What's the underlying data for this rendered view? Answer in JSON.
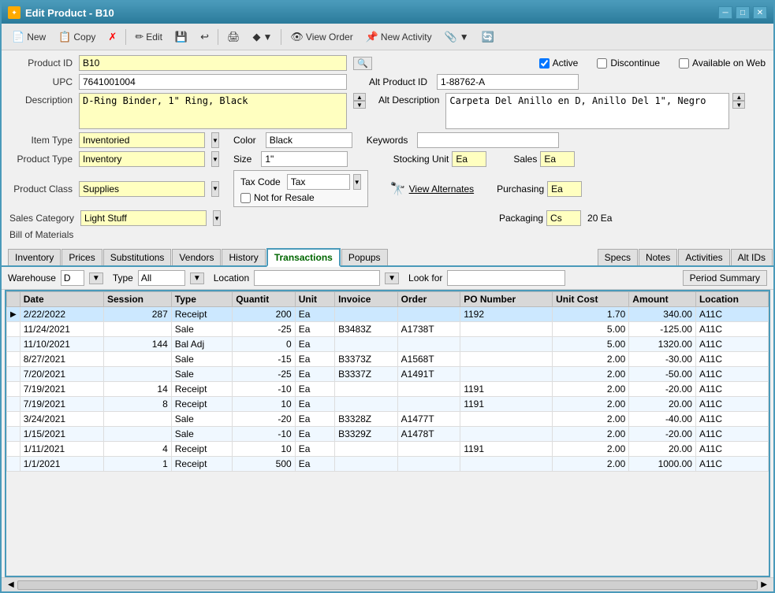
{
  "window": {
    "title": "Edit Product - B10",
    "icon": "✦"
  },
  "toolbar": {
    "buttons": [
      {
        "name": "new-button",
        "label": "New",
        "icon": "📄"
      },
      {
        "name": "copy-button",
        "label": "Copy",
        "icon": "📋"
      },
      {
        "name": "delete-button",
        "label": "",
        "icon": "✗"
      },
      {
        "name": "edit-button",
        "label": "Edit",
        "icon": "✏"
      },
      {
        "name": "save-button",
        "label": "",
        "icon": "💾"
      },
      {
        "name": "undo-button",
        "label": "",
        "icon": "↩"
      },
      {
        "name": "print-button",
        "label": "",
        "icon": "🖨"
      },
      {
        "name": "options-button",
        "label": "",
        "icon": "◆"
      },
      {
        "name": "view-order-button",
        "label": "View Order",
        "icon": "👁"
      },
      {
        "name": "new-activity-button",
        "label": "New Activity",
        "icon": "📌"
      },
      {
        "name": "attach-button",
        "label": "",
        "icon": "📎"
      },
      {
        "name": "refresh-button",
        "label": "",
        "icon": "🔄"
      }
    ]
  },
  "form": {
    "product_id_label": "Product ID",
    "product_id_value": "B10",
    "upc_label": "UPC",
    "upc_value": "7641001004",
    "description_label": "Description",
    "description_value": "D-Ring Binder, 1\" Ring, Black",
    "item_type_label": "Item Type",
    "item_type_value": "Inventoried",
    "product_type_label": "Product Type",
    "product_type_value": "Inventory",
    "product_class_label": "Product Class",
    "product_class_value": "Supplies",
    "sales_category_label": "Sales Category",
    "sales_category_value": "Light Stuff",
    "bill_of_materials_label": "Bill of Materials",
    "color_label": "Color",
    "color_value": "Black",
    "size_label": "Size",
    "size_value": "1\"",
    "tax_code_label": "Tax Code",
    "tax_code_value": "Tax",
    "not_for_resale_label": "Not for Resale",
    "active_label": "Active",
    "active_checked": true,
    "discontinue_label": "Discontinue",
    "discontinue_checked": false,
    "available_on_web_label": "Available on Web",
    "available_on_web_checked": false,
    "alt_product_id_label": "Alt Product ID",
    "alt_product_id_value": "1-88762-A",
    "alt_description_label": "Alt Description",
    "alt_description_value": "Carpeta Del Anillo en D, Anillo Del 1\", Negro",
    "keywords_label": "Keywords",
    "keywords_value": "",
    "stocking_unit_label": "Stocking Unit",
    "stocking_unit_value": "Ea",
    "sales_label": "Sales",
    "sales_value": "Ea",
    "purchasing_label": "Purchasing",
    "purchasing_value": "Ea",
    "packaging_label": "Packaging",
    "packaging_value": "Cs",
    "packaging_qty": "20 Ea",
    "view_alternates_label": "View Alternates"
  },
  "tabs": {
    "items": [
      {
        "name": "tab-inventory",
        "label": "Inventory"
      },
      {
        "name": "tab-prices",
        "label": "Prices"
      },
      {
        "name": "tab-substitutions",
        "label": "Substitutions"
      },
      {
        "name": "tab-vendors",
        "label": "Vendors"
      },
      {
        "name": "tab-history",
        "label": "History"
      },
      {
        "name": "tab-transactions",
        "label": "Transactions"
      },
      {
        "name": "tab-popups",
        "label": "Popups"
      },
      {
        "name": "tab-specs",
        "label": "Specs"
      },
      {
        "name": "tab-notes",
        "label": "Notes"
      },
      {
        "name": "tab-activities",
        "label": "Activities"
      },
      {
        "name": "tab-alt-ids",
        "label": "Alt IDs"
      }
    ],
    "active": "Transactions"
  },
  "transactions": {
    "warehouse_label": "Warehouse",
    "warehouse_value": "D",
    "type_label": "Type",
    "type_value": "All",
    "location_label": "Location",
    "location_value": "",
    "look_for_label": "Look for",
    "look_for_value": "",
    "period_summary_label": "Period Summary",
    "columns": [
      {
        "key": "indicator",
        "label": ""
      },
      {
        "key": "date",
        "label": "Date"
      },
      {
        "key": "session",
        "label": "Session"
      },
      {
        "key": "type",
        "label": "Type"
      },
      {
        "key": "quantity",
        "label": "Quantit"
      },
      {
        "key": "unit",
        "label": "Unit"
      },
      {
        "key": "invoice",
        "label": "Invoice"
      },
      {
        "key": "order",
        "label": "Order"
      },
      {
        "key": "po_number",
        "label": "PO Number"
      },
      {
        "key": "unit_cost",
        "label": "Unit Cost"
      },
      {
        "key": "amount",
        "label": "Amount"
      },
      {
        "key": "location",
        "label": "Location"
      }
    ],
    "rows": [
      {
        "indicator": "▶",
        "date": "2/22/2022",
        "session": "287",
        "type": "Receipt",
        "quantity": "200",
        "unit": "Ea",
        "invoice": "",
        "order": "",
        "po_number": "1192",
        "unit_cost": "1.70",
        "amount": "340.00",
        "location": "A11C",
        "selected": true
      },
      {
        "indicator": "",
        "date": "11/24/2021",
        "session": "",
        "type": "Sale",
        "quantity": "-25",
        "unit": "Ea",
        "invoice": "B3483Z",
        "order": "A1738T",
        "po_number": "",
        "unit_cost": "5.00",
        "amount": "-125.00",
        "location": "A11C",
        "selected": false
      },
      {
        "indicator": "",
        "date": "11/10/2021",
        "session": "144",
        "type": "Bal Adj",
        "quantity": "0",
        "unit": "Ea",
        "invoice": "",
        "order": "",
        "po_number": "",
        "unit_cost": "5.00",
        "amount": "1320.00",
        "location": "A11C",
        "selected": false
      },
      {
        "indicator": "",
        "date": "8/27/2021",
        "session": "",
        "type": "Sale",
        "quantity": "-15",
        "unit": "Ea",
        "invoice": "B3373Z",
        "order": "A1568T",
        "po_number": "",
        "unit_cost": "2.00",
        "amount": "-30.00",
        "location": "A11C",
        "selected": false
      },
      {
        "indicator": "",
        "date": "7/20/2021",
        "session": "",
        "type": "Sale",
        "quantity": "-25",
        "unit": "Ea",
        "invoice": "B3337Z",
        "order": "A1491T",
        "po_number": "",
        "unit_cost": "2.00",
        "amount": "-50.00",
        "location": "A11C",
        "selected": false
      },
      {
        "indicator": "",
        "date": "7/19/2021",
        "session": "14",
        "type": "Receipt",
        "quantity": "-10",
        "unit": "Ea",
        "invoice": "",
        "order": "",
        "po_number": "1191",
        "unit_cost": "2.00",
        "amount": "-20.00",
        "location": "A11C",
        "selected": false
      },
      {
        "indicator": "",
        "date": "7/19/2021",
        "session": "8",
        "type": "Receipt",
        "quantity": "10",
        "unit": "Ea",
        "invoice": "",
        "order": "",
        "po_number": "1191",
        "unit_cost": "2.00",
        "amount": "20.00",
        "location": "A11C",
        "selected": false
      },
      {
        "indicator": "",
        "date": "3/24/2021",
        "session": "",
        "type": "Sale",
        "quantity": "-20",
        "unit": "Ea",
        "invoice": "B3328Z",
        "order": "A1477T",
        "po_number": "",
        "unit_cost": "2.00",
        "amount": "-40.00",
        "location": "A11C",
        "selected": false
      },
      {
        "indicator": "",
        "date": "1/15/2021",
        "session": "",
        "type": "Sale",
        "quantity": "-10",
        "unit": "Ea",
        "invoice": "B3329Z",
        "order": "A1478T",
        "po_number": "",
        "unit_cost": "2.00",
        "amount": "-20.00",
        "location": "A11C",
        "selected": false
      },
      {
        "indicator": "",
        "date": "1/11/2021",
        "session": "4",
        "type": "Receipt",
        "quantity": "10",
        "unit": "Ea",
        "invoice": "",
        "order": "",
        "po_number": "1191",
        "unit_cost": "2.00",
        "amount": "20.00",
        "location": "A11C",
        "selected": false
      },
      {
        "indicator": "",
        "date": "1/1/2021",
        "session": "1",
        "type": "Receipt",
        "quantity": "500",
        "unit": "Ea",
        "invoice": "",
        "order": "",
        "po_number": "",
        "unit_cost": "2.00",
        "amount": "1000.00",
        "location": "A11C",
        "selected": false
      }
    ]
  },
  "colors": {
    "header_bg": "#3a8aaa",
    "tab_active_border": "#4a9aba",
    "table_border": "#4a9aba"
  }
}
